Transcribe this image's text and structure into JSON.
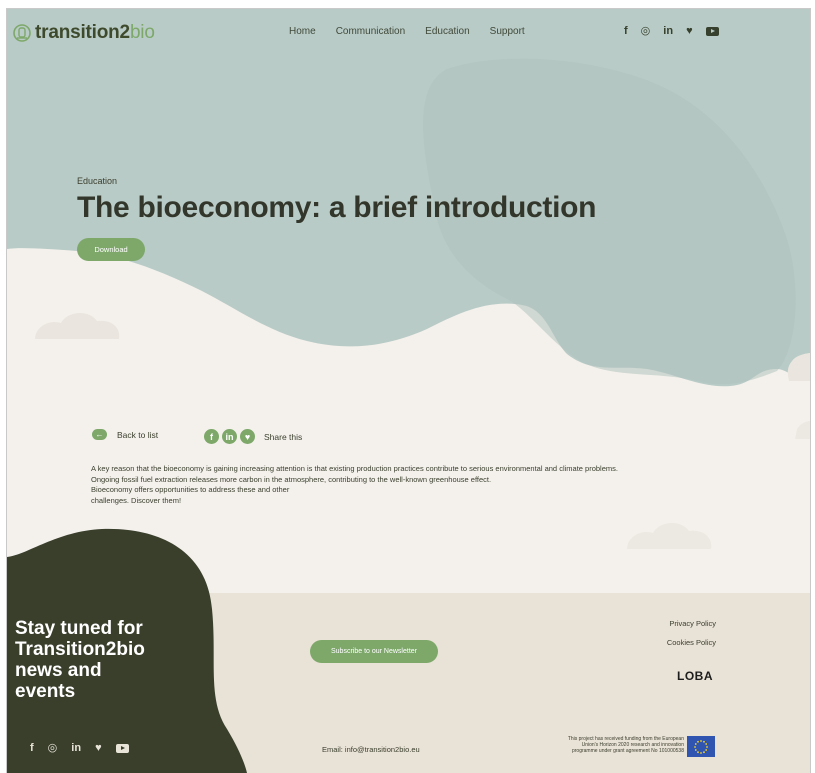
{
  "header": {
    "logo_main": "transition2",
    "logo_accent": "bio",
    "nav": [
      "Home",
      "Communication",
      "Education",
      "Support"
    ],
    "social": [
      "f",
      "◎",
      "in",
      "♥",
      "youtube"
    ]
  },
  "hero": {
    "kicker": "Education",
    "title": "The bioeconomy: a brief introduction",
    "download_label": "Download"
  },
  "actions": {
    "back_label": "Back to list",
    "share_label": "Share this",
    "share_icons": [
      "f",
      "in",
      "♥"
    ]
  },
  "body": {
    "lines": [
      "A key reason that the bioeconomy is gaining increasing attention is that existing production practices contribute to serious environmental and climate problems.",
      "Ongoing fossil fuel extraction releases more carbon in the atmosphere, contributing to the well-known greenhouse effect.",
      "Bioeconomy offers opportunities to address these and other",
      "challenges. Discover them!"
    ]
  },
  "footer": {
    "title_lines": [
      "Stay tuned for",
      "Transition2bio",
      "news and",
      "events"
    ],
    "subscribe_label": "Subscribe to our Newsletter",
    "privacy_label": "Privacy Policy",
    "cookies_label": "Cookies Policy",
    "loba_label": "LOBA",
    "email_label": "Email: info@transition2bio.eu",
    "funding_lines": [
      "This project has received funding from the European",
      "Union's Horizon 2020 research and innovation",
      "programme under grant agreement No 101000538"
    ]
  },
  "colors": {
    "hero_bg": "#b9cbc7",
    "page_bg": "#f4f1ec",
    "footer_bg": "#e9e2d6",
    "dark_green": "#3a3f2c",
    "accent_green": "#7da86a"
  }
}
